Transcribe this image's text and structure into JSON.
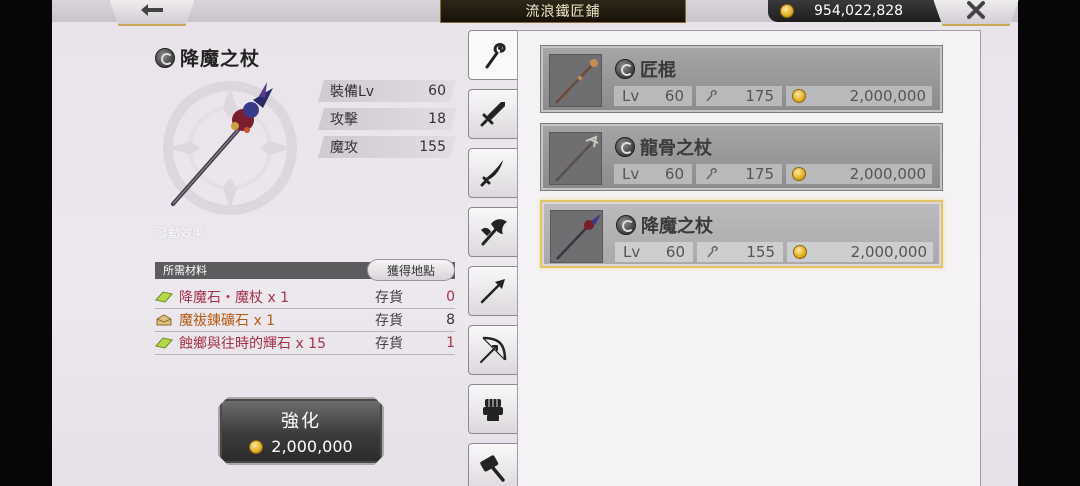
{
  "header": {
    "back_icon": "left-arrow-icon",
    "title": "流浪鐵匠鋪",
    "currency": "954,022,828",
    "close_icon": "close-x-icon"
  },
  "detail": {
    "name": "降魔之杖",
    "effect_label": "發動效果",
    "stats": [
      {
        "label": "裝備Lv",
        "value": "60"
      },
      {
        "label": "攻擊",
        "value": "18"
      },
      {
        "label": "魔攻",
        "value": "155"
      }
    ]
  },
  "materials": {
    "header": "所需材料",
    "obtain_button": "獲得地點",
    "stock_label": "存貨",
    "items": [
      {
        "name": "降魔石・魔杖 x 1",
        "stock": "0",
        "color": "#a8314a",
        "icon": "green-crystal-icon"
      },
      {
        "name": "魔祓鍊礦石 x 1",
        "stock": "8",
        "color": "#b55a12",
        "icon": "ore-icon"
      },
      {
        "name": "蝕鄉與往時的輝石 x 15",
        "stock": "1",
        "color": "#a8314a",
        "icon": "green-crystal-icon"
      }
    ]
  },
  "enhance": {
    "label": "強化",
    "cost": "2,000,000"
  },
  "tabs": [
    "staff-icon",
    "sword-icon",
    "katana-icon",
    "axe-icon",
    "spear-icon",
    "bow-icon",
    "gauntlet-icon",
    "hammer-icon"
  ],
  "weapons": [
    {
      "name": "匠棍",
      "lv_label": "Lv",
      "lv": "60",
      "atk": "175",
      "price": "2,000,000",
      "selected": false
    },
    {
      "name": "龍骨之杖",
      "lv_label": "Lv",
      "lv": "60",
      "atk": "175",
      "price": "2,000,000",
      "selected": false
    },
    {
      "name": "降魔之杖",
      "lv_label": "Lv",
      "lv": "60",
      "atk": "155",
      "price": "2,000,000",
      "selected": true
    }
  ]
}
